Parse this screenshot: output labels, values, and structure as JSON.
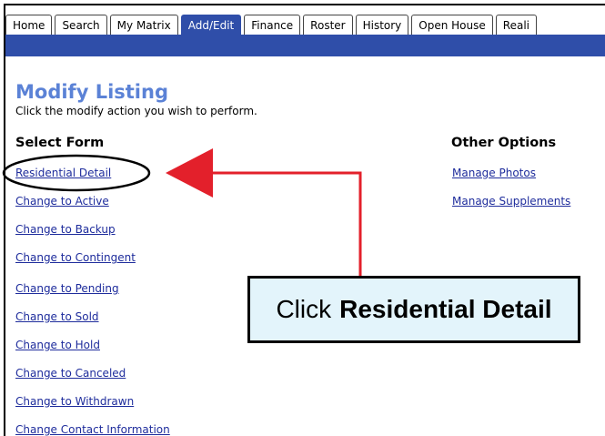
{
  "tabs": [
    {
      "label": "Home",
      "active": false
    },
    {
      "label": "Search",
      "active": false
    },
    {
      "label": "My Matrix",
      "active": false
    },
    {
      "label": "Add/Edit",
      "active": true
    },
    {
      "label": "Finance",
      "active": false
    },
    {
      "label": "Roster",
      "active": false
    },
    {
      "label": "History",
      "active": false
    },
    {
      "label": "Open House",
      "active": false
    },
    {
      "label": "Reali",
      "active": false
    }
  ],
  "page": {
    "title": "Modify Listing",
    "subtitle": "Click the modify action you wish to perform."
  },
  "select_form": {
    "heading": "Select Form",
    "links": [
      "Residential Detail",
      "Change to Active",
      "Change to Backup",
      "Change to Contingent",
      "Change to Pending",
      "Change to Sold",
      "Change to Hold",
      "Change to Canceled",
      "Change to Withdrawn",
      "Change Contact Information"
    ]
  },
  "other_options": {
    "heading": "Other Options",
    "links": [
      "Manage Photos",
      "Manage Supplements"
    ]
  },
  "callout": {
    "prefix": "Click",
    "emphasis": "Residential Detail"
  },
  "colors": {
    "accent_blue": "#2f4ea9",
    "title_blue": "#5b82d6",
    "link_blue": "#1e2c9c",
    "arrow_red": "#e3202b",
    "callout_bg": "#e3f4fb"
  }
}
